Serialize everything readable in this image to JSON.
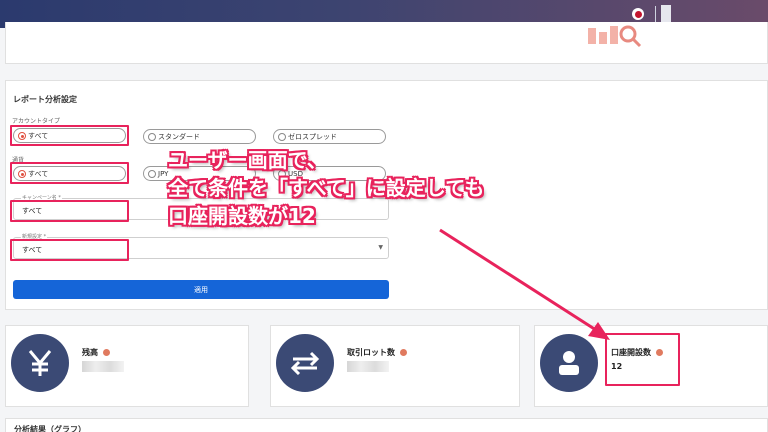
{
  "report_settings": {
    "title": "レポート分析設定",
    "account_type": {
      "label": "アカウントタイプ",
      "options": [
        "すべて",
        "スタンダード",
        "ゼロスプレッド"
      ],
      "selected": "すべて"
    },
    "currency": {
      "label": "通貨",
      "options": [
        "すべて",
        "JPY",
        "USD"
      ],
      "selected": "すべて"
    },
    "campaign": {
      "label": "キャンペーン名 *",
      "value": "すべて"
    },
    "new_setting": {
      "label": "新規設定 *",
      "value": "すべて"
    },
    "apply_label": "適用"
  },
  "metrics": [
    {
      "label": "残高",
      "icon": "yen-icon",
      "value": ""
    },
    {
      "label": "取引ロット数",
      "icon": "swap-arrows-icon",
      "value": ""
    },
    {
      "label": "口座開設数",
      "icon": "person-icon",
      "value": "12"
    }
  ],
  "results_title": "分析結果（グラフ）",
  "annotation": {
    "line1": "ユーザー画面で、",
    "line2": "全て条件を「すべて」に設定しても",
    "line3": "口座開設数が12"
  },
  "colors": {
    "highlight": "#e8235c",
    "primary_button": "#1565d8",
    "metric_icon_bg": "#3b4a75",
    "header": "#2b3a6e"
  }
}
